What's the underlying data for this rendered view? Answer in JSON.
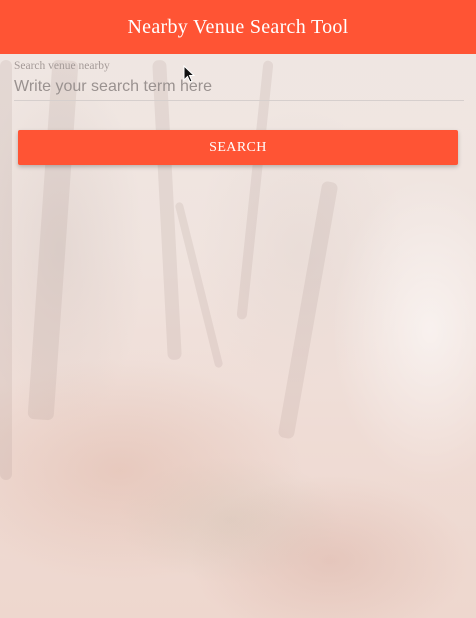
{
  "header": {
    "title": "Nearby Venue Search Tool"
  },
  "search": {
    "label": "Search venue nearby",
    "placeholder": "Write your search term here",
    "value": ""
  },
  "actions": {
    "search_label": "SEARCH"
  },
  "colors": {
    "accent": "#ff5434",
    "header_text": "#ffffff",
    "label_text": "#a49a98",
    "placeholder_text": "#9a9290"
  },
  "icons": {
    "cursor": "mouse-pointer-icon"
  }
}
